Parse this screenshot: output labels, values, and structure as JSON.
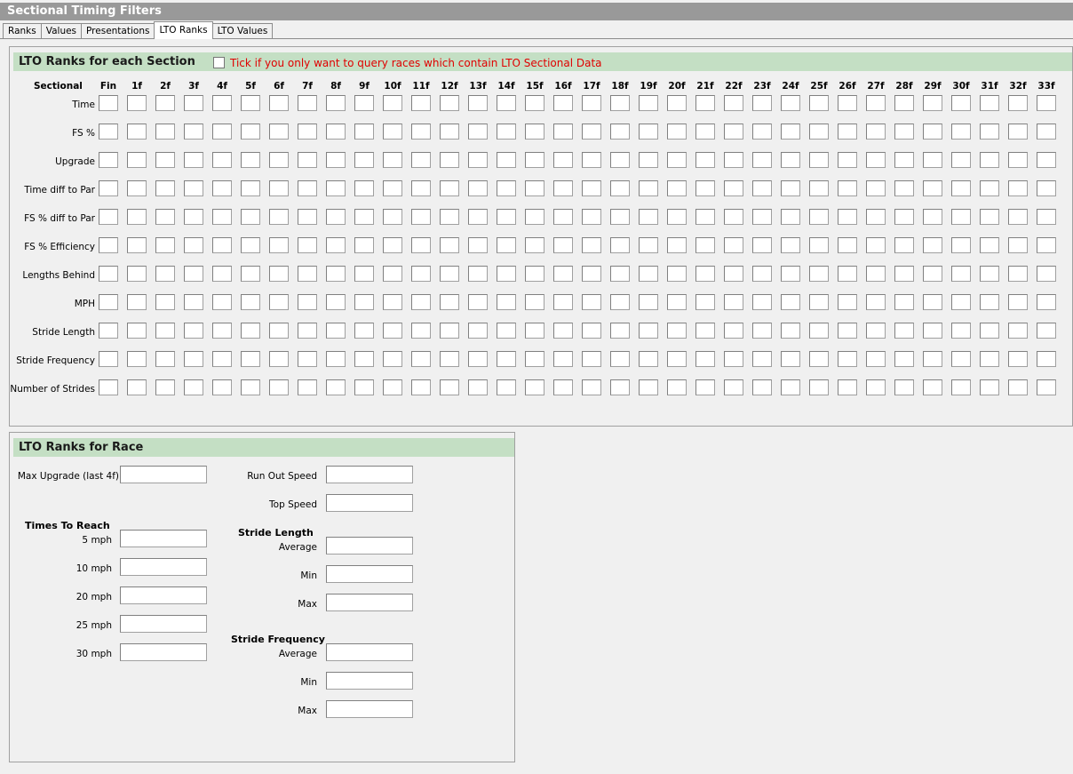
{
  "window": {
    "title": "Sectional Timing Filters"
  },
  "tabs": [
    {
      "label": "Ranks"
    },
    {
      "label": "Values"
    },
    {
      "label": "Presentations"
    },
    {
      "label": "LTO Ranks"
    },
    {
      "label": "LTO Values"
    }
  ],
  "section_panel": {
    "title": "LTO Ranks for each Section",
    "checkbox_label": "Tick if you only want to query races which contain LTO Sectional Data",
    "checkbox_checked": false,
    "corner_label": "Sectional",
    "columns": [
      "Fin",
      "1f",
      "2f",
      "3f",
      "4f",
      "5f",
      "6f",
      "7f",
      "8f",
      "9f",
      "10f",
      "11f",
      "12f",
      "13f",
      "14f",
      "15f",
      "16f",
      "17f",
      "18f",
      "19f",
      "20f",
      "21f",
      "22f",
      "23f",
      "24f",
      "25f",
      "26f",
      "27f",
      "28f",
      "29f",
      "30f",
      "31f",
      "32f",
      "33f"
    ],
    "rows": [
      "Time",
      "FS %",
      "Upgrade",
      "Time diff to Par",
      "FS % diff to Par",
      "FS % Efficiency",
      "Lengths Behind",
      "MPH",
      "Stride Length",
      "Stride Frequency",
      "Number of Strides"
    ]
  },
  "race_panel": {
    "title": "LTO Ranks for Race",
    "max_upgrade_label": "Max Upgrade (last 4f)",
    "times_to_reach_heading": "Times To Reach",
    "times_to_reach": [
      "5 mph",
      "10 mph",
      "20 mph",
      "25 mph",
      "30 mph"
    ],
    "run_out_speed_label": "Run Out Speed",
    "top_speed_label": "Top Speed",
    "stride_length_heading": "Stride Length",
    "stride_length_fields": [
      "Average",
      "Min",
      "Max"
    ],
    "stride_frequency_heading": "Stride Frequency",
    "stride_frequency_fields": [
      "Average",
      "Min",
      "Max"
    ]
  }
}
